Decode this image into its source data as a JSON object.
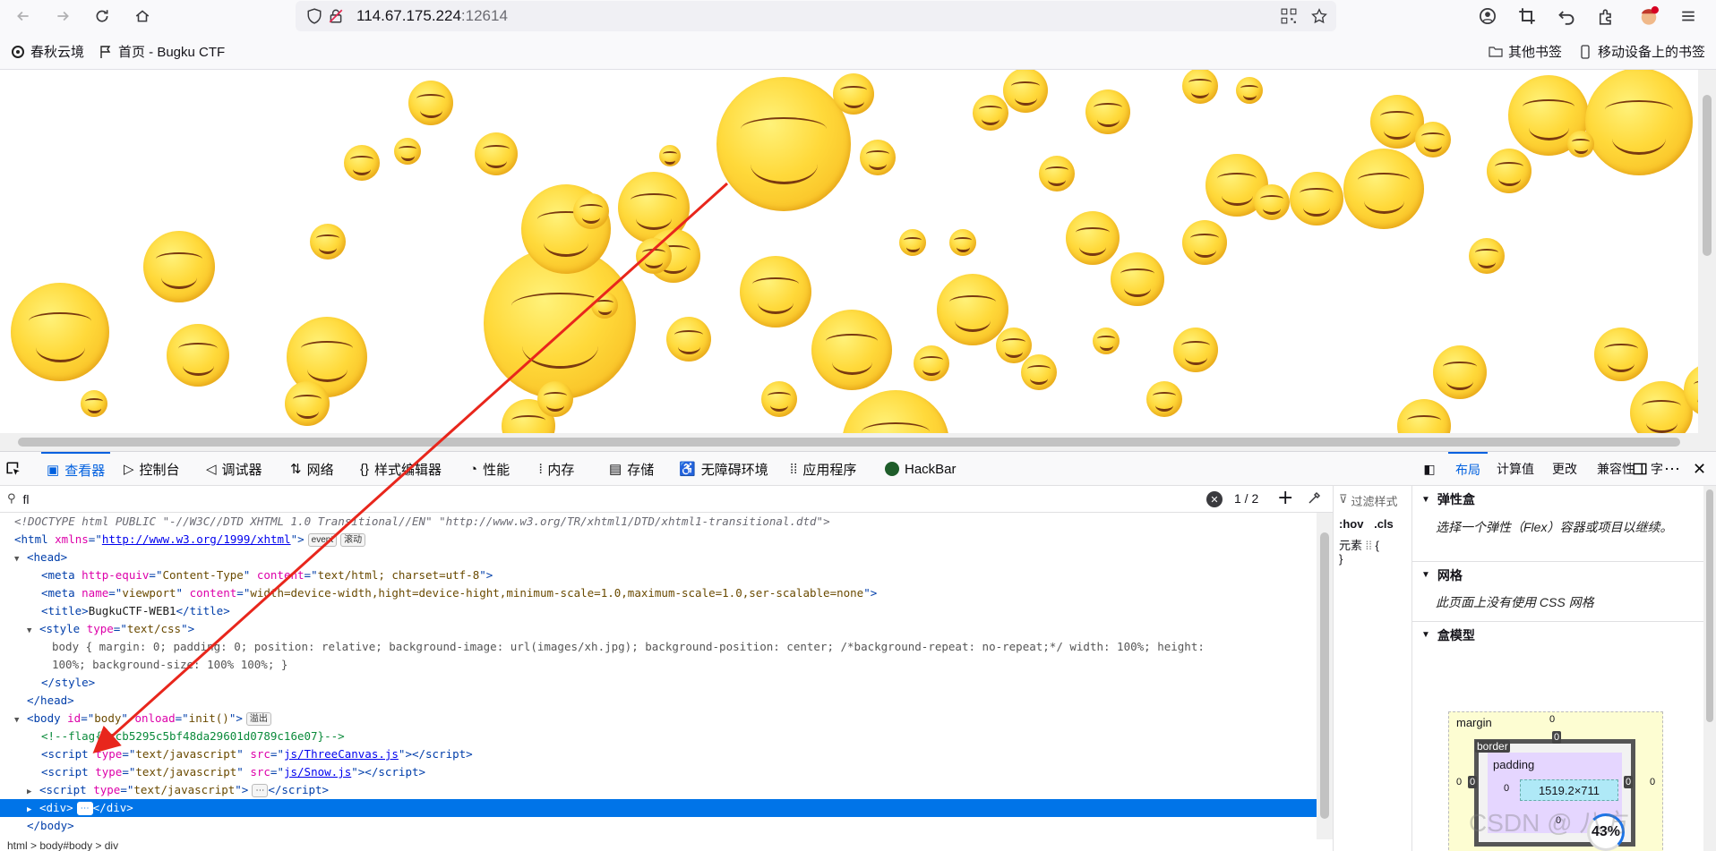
{
  "browser": {
    "url_host": "114.67.175.224",
    "url_port": ":12614",
    "bookmarks": [
      {
        "label": "春秋云境"
      },
      {
        "label": "首页 - Bugku CTF"
      }
    ],
    "bookmarks_right": [
      {
        "label": "其他书签"
      },
      {
        "label": "移动设备上的书签"
      }
    ]
  },
  "devtools": {
    "tabs": [
      {
        "label": "查看器"
      },
      {
        "label": "控制台"
      },
      {
        "label": "调试器"
      },
      {
        "label": "网络"
      },
      {
        "label": "样式编辑器"
      },
      {
        "label": "性能"
      },
      {
        "label": "内存"
      },
      {
        "label": "存储"
      },
      {
        "label": "无障碍环境"
      },
      {
        "label": "应用程序"
      },
      {
        "label": "HackBar"
      }
    ],
    "search_value": "fl",
    "search_count": "1 / 2",
    "breadcrumbs": "html > body#body > div",
    "markup": {
      "doctype": "<!DOCTYPE html PUBLIC \"-//W3C//DTD XHTML 1.0 Transitional//EN\" \"http://www.w3.org/TR/xhtml1/DTD/xhtml1-transitional.dtd\">",
      "html_xmlns": "http://www.w3.org/1999/xhtml",
      "badge_event": "event",
      "badge_scroll": "滚动",
      "badge_overflow": "溢出",
      "meta1_equiv": "Content-Type",
      "meta1_content": "text/html; charset=utf-8",
      "meta2_name": "viewport",
      "meta2_content": "width=device-width,hight=device-hight,minimum-scale=1.0,maximum-scale=1.0,ser-scalable=none",
      "title": "BugkuCTF-WEB1",
      "style_type": "text/css",
      "css_line1": "body { margin: 0; padding: 0; position: relative; background-image: url(images/xh.jpg); background-position: center; /*background-repeat: no-repeat;*/ width: 100%; height:",
      "css_line2": "100%; background-size: 100% 100%; }",
      "body_id": "body",
      "body_onload": "init()",
      "flag_comment": "<!--flag{2ccb5295c5bf48da29601d0789c16e07}-->",
      "script_type": "text/javascript",
      "script1_src": "js/ThreeCanvas.js",
      "script2_src": "js/Snow.js"
    },
    "rules": {
      "filter_placeholder": "过滤样式",
      "hov": ":hov",
      "cls": ".cls",
      "element_label": "元素",
      "brace_open": "{",
      "brace_close": "}"
    },
    "layout": {
      "tabs": [
        {
          "label": "布局"
        },
        {
          "label": "计算值"
        },
        {
          "label": "更改"
        },
        {
          "label": "兼容性"
        },
        {
          "label": "字"
        }
      ],
      "flex_title": "弹性盒",
      "flex_desc": "选择一个弹性（Flex）容器或项目以继续。",
      "grid_title": "网格",
      "grid_desc": "此页面上没有使用 CSS 网格",
      "box_title": "盒模型",
      "box": {
        "margin_label": "margin",
        "border_label": "border",
        "padding_label": "padding",
        "content_size": "1519.2×711",
        "zero": "0"
      },
      "progress_label": "43%",
      "progress_value": 43
    }
  },
  "colors": {
    "accent": "#0060df",
    "selection": "#0074e8",
    "annotation_arrow": "#e8261c"
  },
  "watermark": "CSDN @ 八方"
}
